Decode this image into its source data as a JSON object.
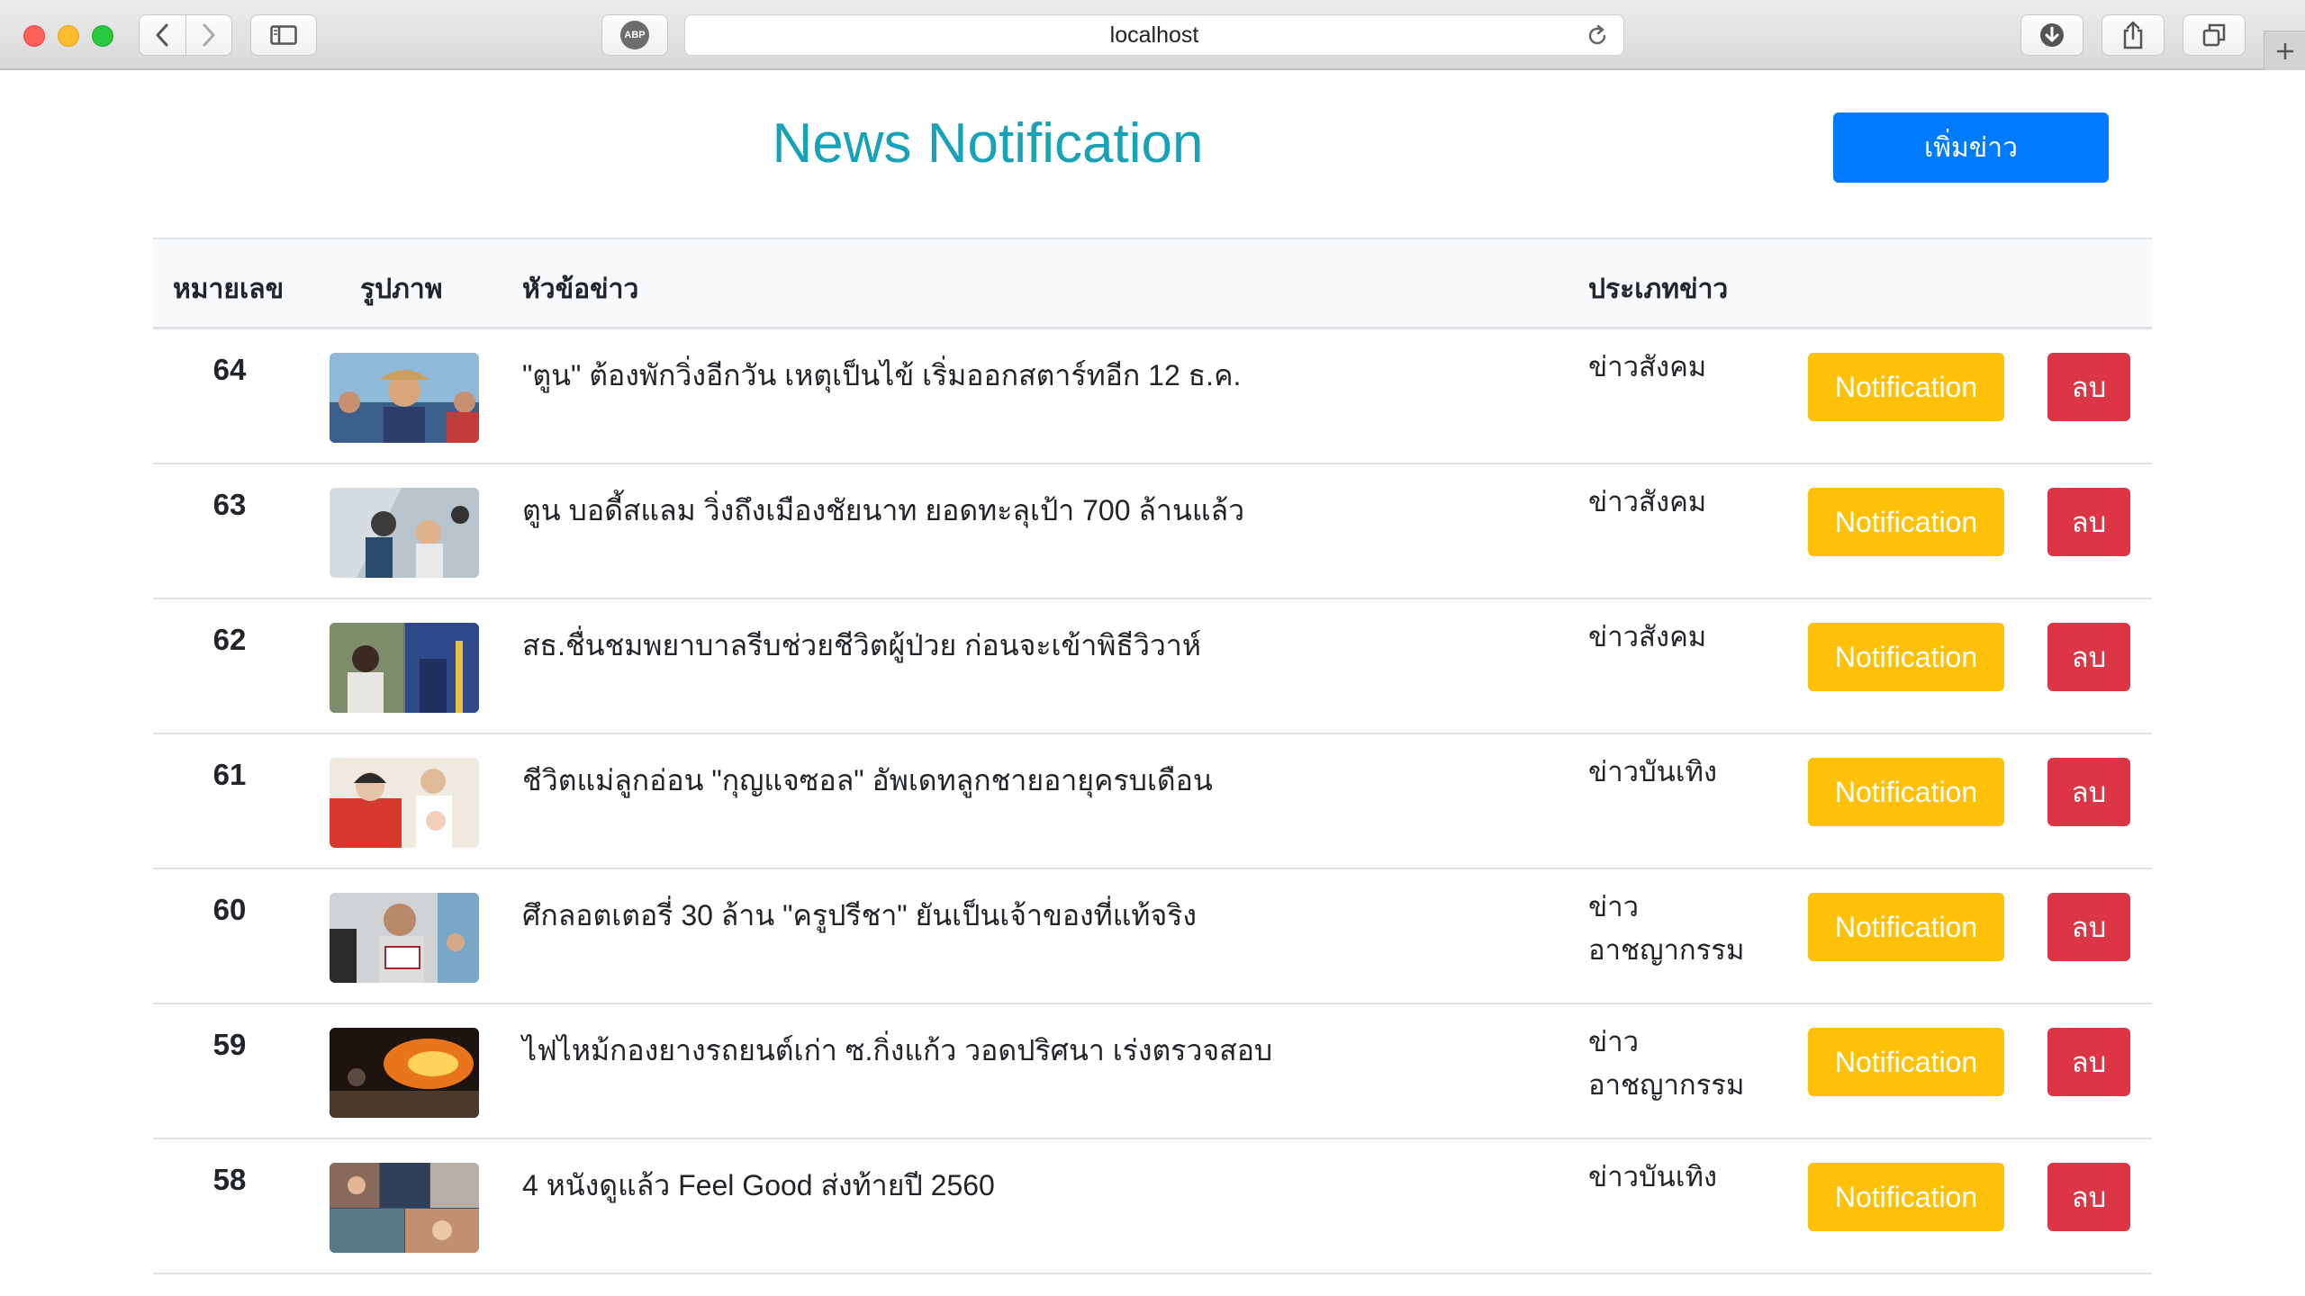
{
  "browser": {
    "url": "localhost",
    "abp_label": "ABP"
  },
  "page": {
    "title": "News Notification",
    "add_button_label": "เพิ่มข่าว"
  },
  "table": {
    "headers": {
      "number": "หมายเลข",
      "image": "รูปภาพ",
      "title": "หัวข้อข่าว",
      "type": "ประเภทข่าว"
    },
    "rows": [
      {
        "id": "64",
        "title": "\"ตูน\" ต้องพักวิ่งอีกวัน เหตุเป็นไข้ เริ่มออกสตาร์ทอีก 12 ธ.ค.",
        "type": "ข่าวสังคม",
        "notify_label": "Notification",
        "delete_label": "ลบ"
      },
      {
        "id": "63",
        "title": "ตูน บอดี้สแลม วิ่งถึงเมืองชัยนาท ยอดทะลุเป้า 700 ล้านแล้ว",
        "type": "ข่าวสังคม",
        "notify_label": "Notification",
        "delete_label": "ลบ"
      },
      {
        "id": "62",
        "title": "สธ.ชื่นชมพยาบาลรีบช่วยชีวิตผู้ป่วย ก่อนจะเข้าพิธีวิวาห์",
        "type": "ข่าวสังคม",
        "notify_label": "Notification",
        "delete_label": "ลบ"
      },
      {
        "id": "61",
        "title": "ชีวิตแม่ลูกอ่อน \"กุญแจซอล\" อัพเดทลูกชายอายุครบเดือน",
        "type": "ข่าวบันเทิง",
        "notify_label": "Notification",
        "delete_label": "ลบ"
      },
      {
        "id": "60",
        "title": "ศึกลอตเตอรี่ 30 ล้าน \"ครูปรีชา\" ยันเป็นเจ้าของที่แท้จริง",
        "type": "ข่าวอาชญากรรม",
        "notify_label": "Notification",
        "delete_label": "ลบ"
      },
      {
        "id": "59",
        "title": "ไฟไหม้กองยางรถยนต์เก่า ซ.กิ่งแก้ว วอดปริศนา เร่งตรวจสอบ",
        "type": "ข่าวอาชญากรรม",
        "notify_label": "Notification",
        "delete_label": "ลบ"
      },
      {
        "id": "58",
        "title": "4 หนังดูแล้ว Feel Good ส่งท้ายปี 2560",
        "type": "ข่าวบันเทิง",
        "notify_label": "Notification",
        "delete_label": "ลบ"
      }
    ]
  },
  "colors": {
    "title": "#17a2b8",
    "primary": "#007bff",
    "warning": "#ffc107",
    "danger": "#dc3545"
  },
  "icons": [
    "back-icon",
    "forward-icon",
    "sidebar-icon",
    "adblock-icon",
    "reload-icon",
    "download-icon",
    "share-icon",
    "tabs-icon",
    "plus-icon"
  ]
}
